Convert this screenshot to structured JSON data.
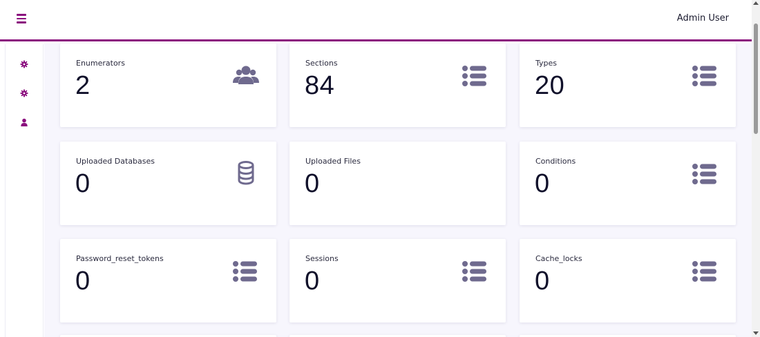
{
  "header": {
    "user_name": "Admin User",
    "menu_icon": "hamburger-icon"
  },
  "sidebar": {
    "items": [
      {
        "icon": "gear-icon"
      },
      {
        "icon": "gear-icon"
      },
      {
        "icon": "user-icon"
      }
    ]
  },
  "colors": {
    "accent": "#8b0f7e",
    "icon": "#6f6a8e",
    "background": "#f7f6fd"
  },
  "cards": [
    {
      "title": "Enumerators",
      "value": "2",
      "icon": "users-icon"
    },
    {
      "title": "Sections",
      "value": "84",
      "icon": "list-icon"
    },
    {
      "title": "Types",
      "value": "20",
      "icon": "list-icon"
    },
    {
      "title": "Uploaded Databases",
      "value": "0",
      "icon": "database-icon"
    },
    {
      "title": "Uploaded Files",
      "value": "0",
      "icon": ""
    },
    {
      "title": "Conditions",
      "value": "0",
      "icon": "list-icon"
    },
    {
      "title": "Password_reset_tokens",
      "value": "0",
      "icon": "list-icon"
    },
    {
      "title": "Sessions",
      "value": "0",
      "icon": "list-icon"
    },
    {
      "title": "Cache_locks",
      "value": "0",
      "icon": "list-icon"
    }
  ]
}
